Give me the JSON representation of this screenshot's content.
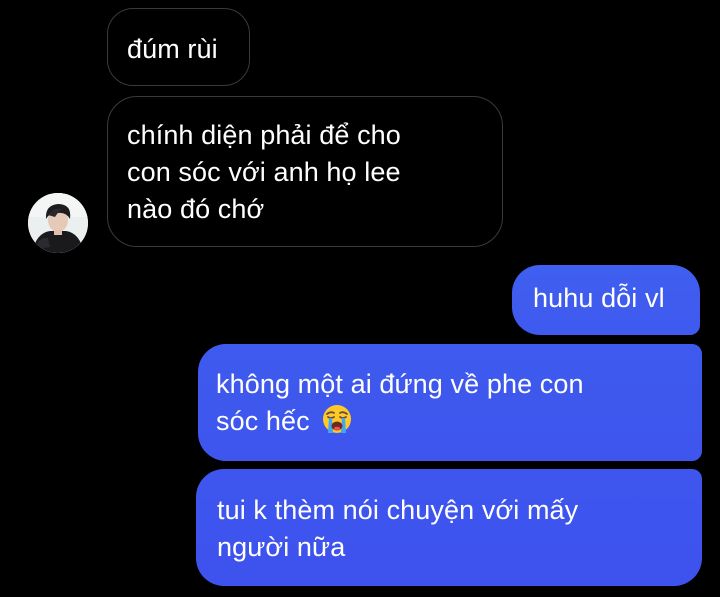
{
  "thread": {
    "messages": [
      {
        "sender": "other",
        "lines": [
          "đúm rùi"
        ]
      },
      {
        "sender": "other",
        "lines": [
          "chính diện phải để cho",
          "con sóc với anh họ lee",
          "nào đó chớ"
        ]
      },
      {
        "sender": "self",
        "lines": [
          "huhu dỗi vl"
        ]
      },
      {
        "sender": "self",
        "lines": [
          "không một ai đứng về phe con",
          "sóc hếc"
        ],
        "emoji": "loudly-crying-face"
      },
      {
        "sender": "self",
        "lines": [
          "tui k thèm nói chuyện với mấy",
          "người nữa"
        ]
      }
    ]
  },
  "colors": {
    "background": "#000000",
    "incoming_bubble": "#000000",
    "incoming_border": "#3a3a3a",
    "outgoing_gradient": [
      "#3b82f0",
      "#3d6df1",
      "#3f5cef",
      "#3e56ee",
      "#3e52ed"
    ],
    "text": "#ffffff"
  }
}
